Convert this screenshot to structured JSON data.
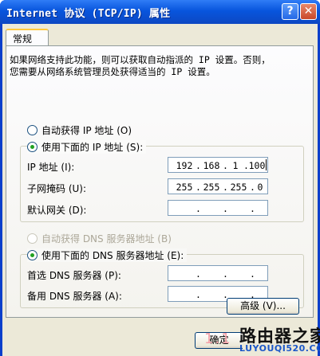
{
  "window": {
    "title": "Internet 协议 (TCP/IP) 属性",
    "help_icon": "?",
    "close_icon": "✕"
  },
  "tab": {
    "label": "常规"
  },
  "description": "如果网络支持此功能，则可以获取自动指派的 IP 设置。否则，\n您需要从网络系统管理员处获得适当的 IP 设置。",
  "ip": {
    "auto_label": "自动获得 IP 地址 (O)",
    "manual_label": "使用下面的 IP 地址 (S):",
    "address_label": "IP 地址 (I):",
    "address": [
      "192",
      "168",
      "1",
      "100"
    ],
    "subnet_label": "子网掩码 (U):",
    "subnet": [
      "255",
      "255",
      "255",
      "0"
    ],
    "gateway_label": "默认网关 (D):",
    "gateway": [
      "",
      "",
      "",
      ""
    ]
  },
  "dns": {
    "auto_label": "自动获得 DNS 服务器地址 (B)",
    "manual_label": "使用下面的 DNS 服务器地址 (E):",
    "preferred_label": "首选 DNS 服务器 (P):",
    "preferred": [
      "",
      "",
      "",
      ""
    ],
    "alternate_label": "备用 DNS 服务器 (A):",
    "alternate": [
      "",
      "",
      "",
      ""
    ]
  },
  "buttons": {
    "advanced": "高级 (V)...",
    "ok": "确定"
  },
  "watermark": {
    "faint": "1.1",
    "title": "路由器之家",
    "url": "LUYOUQI520.COM"
  },
  "colors": {
    "titlebar": "#0855dd",
    "face": "#ece9d8",
    "selected_radio": "#21a121"
  }
}
